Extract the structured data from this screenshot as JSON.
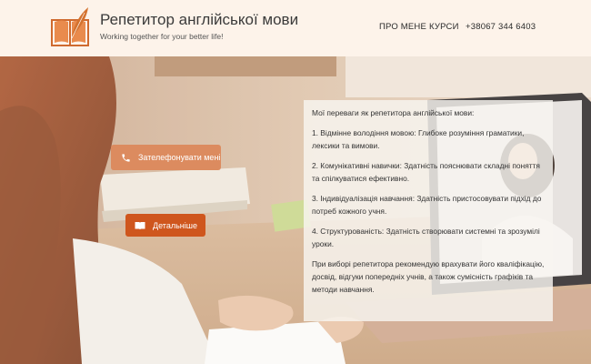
{
  "header": {
    "title": "Репетитор англійської мови",
    "tagline": "Working together for your better life!",
    "nav": [
      {
        "label": "ПРО МЕНЕ"
      },
      {
        "label": "КУРСИ"
      },
      {
        "label": "+38067 344 6403"
      }
    ]
  },
  "hero": {
    "call_button": {
      "label": "Зателефонувати мені",
      "icon": "phone-icon"
    },
    "more_button": {
      "label": "Детальніше",
      "icon": "book-icon"
    },
    "panel": {
      "heading": "Мої переваги як репетитора англійської мови:",
      "points": [
        "1. Відмінне володіння мовою: Глибоке розуміння граматики, лексики та вимови.",
        "2. Комунікативні навички: Здатність пояснювати складні поняття та спілкуватися ефективно.",
        "3. Індивідуалізація навчання: Здатність пристосовувати підхід до потреб кожного учня.",
        "4. Структурованість: Здатність створювати системні та зрозумілі уроки."
      ],
      "closing": "При виборі репетитора рекомендую врахувати його кваліфікацію, досвід, відгуки попередніх учнів, а також сумісність графіків та методи навчання."
    }
  },
  "colors": {
    "header_bg": "#fdf3ea",
    "accent": "#cf561d",
    "accent_light": "#dc8b5f"
  }
}
